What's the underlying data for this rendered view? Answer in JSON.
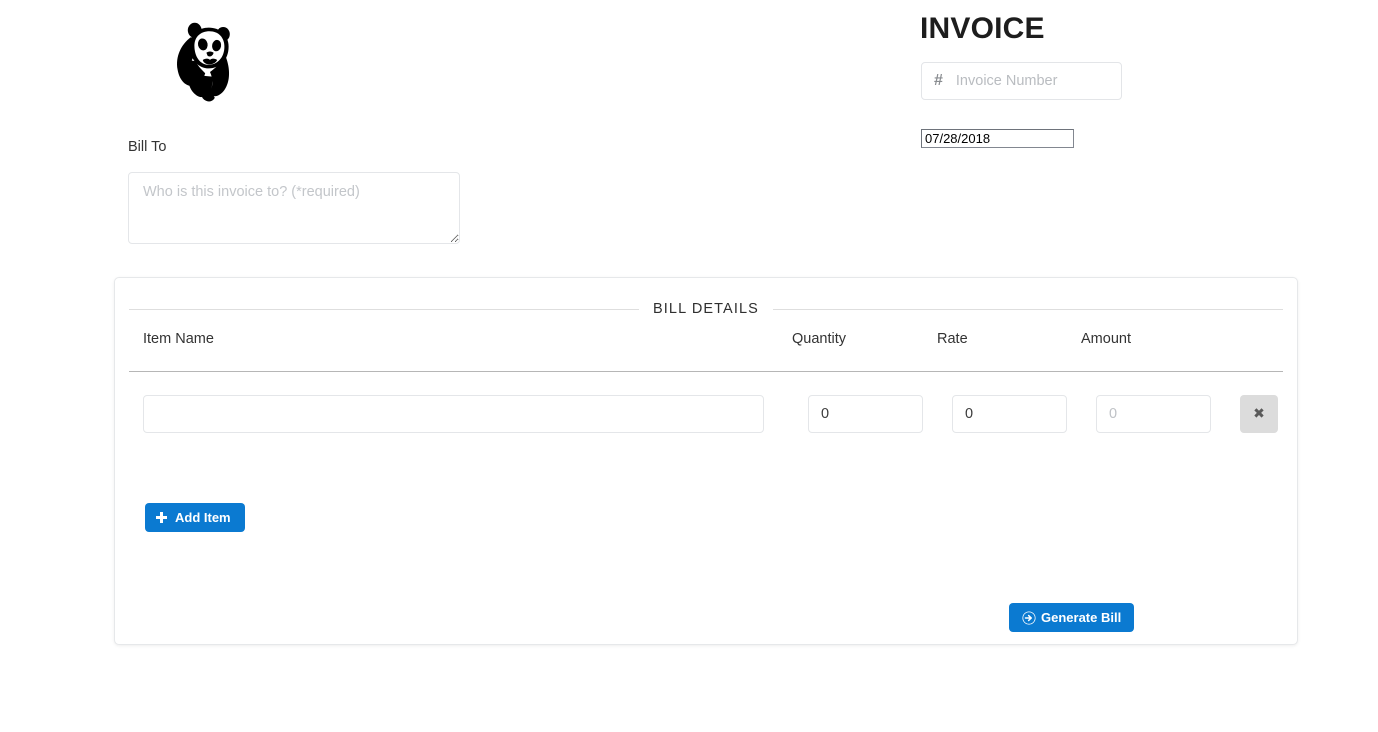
{
  "brand": {
    "logo_icon": "wwf-panda-logo"
  },
  "header": {
    "title": "INVOICE",
    "invoice_number": {
      "icon": "hash-icon",
      "value": "",
      "placeholder": "Invoice Number"
    },
    "date": {
      "value": "07/28/2018"
    }
  },
  "bill_to": {
    "label": "Bill To",
    "value": "",
    "placeholder": "Who is this invoice to? (*required)"
  },
  "bill_details": {
    "legend": "BILL DETAILS",
    "columns": {
      "item_name": "Item Name",
      "quantity": "Quantity",
      "rate": "Rate",
      "amount": "Amount"
    },
    "rows": [
      {
        "item_name": "",
        "item_name_placeholder": "",
        "quantity": "0",
        "rate": "0",
        "amount": "",
        "amount_placeholder": "0",
        "delete_icon": "close-x-icon"
      }
    ],
    "add_item_label": "Add Item",
    "add_item_icon": "plus-icon",
    "generate_label": "Generate Bill",
    "generate_icon": "arrow-circle-right-icon"
  },
  "colors": {
    "accent_blue": "#0b7ad1",
    "delete_button_bg": "#dcdcdc",
    "border_light": "#e4e6e9",
    "text_dark": "#2b2b2b",
    "placeholder_grey": "#bfc2c6"
  }
}
